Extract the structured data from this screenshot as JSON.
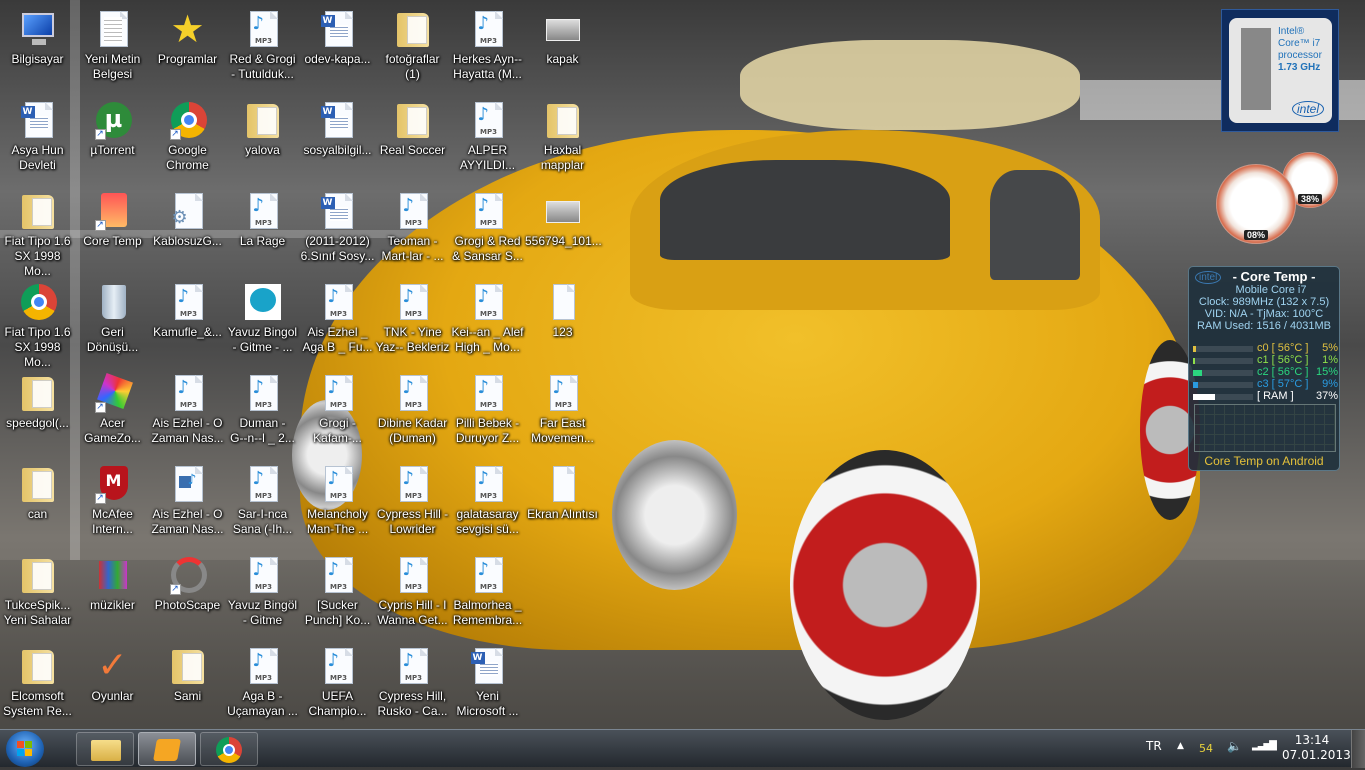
{
  "desktop": {
    "columns": [
      [
        {
          "label": "Bilgisayar",
          "icon": "computer-icon"
        },
        {
          "label": "Asya Hun\nDevleti",
          "icon": "word-document-icon"
        },
        {
          "label": "Fiat Tipo 1.6\nSX 1998 Mo...",
          "icon": "folder-icon"
        },
        {
          "label": "Fiat Tipo 1.6\nSX 1998 Mo...",
          "icon": "chrome-icon"
        },
        {
          "label": "speedgol(...",
          "icon": "folder-icon"
        },
        {
          "label": "can",
          "icon": "folder-icon"
        },
        {
          "label": "TukceSpik...\nYeni Sahalar",
          "icon": "folder-icon"
        },
        {
          "label": "Elcomsoft\nSystem Re...",
          "icon": "folder-icon"
        }
      ],
      [
        {
          "label": "Yeni Metin\nBelgesi",
          "icon": "text-document-icon"
        },
        {
          "label": "µTorrent",
          "icon": "utorrent-icon",
          "shortcut": true
        },
        {
          "label": "Core Temp",
          "icon": "core-temp-icon",
          "shortcut": true
        },
        {
          "label": "Geri\nDönüşü...",
          "icon": "recycle-bin-icon"
        },
        {
          "label": "Acer\nGameZo...",
          "icon": "acer-gamezone-icon",
          "shortcut": true
        },
        {
          "label": "McAfee\nIntern...",
          "icon": "mcafee-icon",
          "shortcut": true
        },
        {
          "label": "müzikler",
          "icon": "winrar-archive-icon"
        },
        {
          "label": "Oyunlar",
          "icon": "checkmark-icon"
        }
      ],
      [
        {
          "label": "Programlar",
          "icon": "star-icon"
        },
        {
          "label": "Google\nChrome",
          "icon": "chrome-icon",
          "shortcut": true
        },
        {
          "label": "KablosuzG...",
          "icon": "config-file-icon"
        },
        {
          "label": "Kamufle_&...",
          "icon": "mp3-icon"
        },
        {
          "label": "Ais Ezhel - O\nZaman Nas...",
          "icon": "mp3-icon"
        },
        {
          "label": "Ais Ezhel - O\nZaman Nas...",
          "icon": "video-file-icon"
        },
        {
          "label": "PhotoScape",
          "icon": "photoscape-icon",
          "shortcut": true
        },
        {
          "label": "Sami",
          "icon": "folder-icon"
        }
      ],
      [
        {
          "label": "Red & Grogi\n- Tutulduk...",
          "icon": "mp3-icon"
        },
        {
          "label": "yalova",
          "icon": "folder-icon"
        },
        {
          "label": "La Rage",
          "icon": "mp3-icon"
        },
        {
          "label": "Yavuz Bingol\n- Gitme - ...",
          "icon": "mp3-app-icon"
        },
        {
          "label": "Duman -\nG--n--l _ 2...",
          "icon": "mp3-icon"
        },
        {
          "label": "Sar-I-nca\nSana (-Ih...",
          "icon": "mp3-icon"
        },
        {
          "label": "Yavuz Bingöl\n- Gitme",
          "icon": "mp3-icon"
        },
        {
          "label": "Aga B -\nUçamayan ...",
          "icon": "mp3-icon"
        }
      ],
      [
        {
          "label": "odev-kapa...",
          "icon": "word-document-icon"
        },
        {
          "label": "sosyalbilgil...",
          "icon": "word-document-icon"
        },
        {
          "label": "(2011-2012)\n6.Sınıf Sosy...",
          "icon": "word-document-icon"
        },
        {
          "label": "Ais Ezhel _\nAga B _ Fu...",
          "icon": "mp3-icon"
        },
        {
          "label": "Grogi -\nKafam-...",
          "icon": "mp3-icon"
        },
        {
          "label": "Melancholy\nMan-The ...",
          "icon": "mp3-icon"
        },
        {
          "label": "[Sucker\nPunch] Ko...",
          "icon": "mp3-icon"
        },
        {
          "label": "UEFA\nChampio...",
          "icon": "mp3-icon"
        }
      ],
      [
        {
          "label": "fotoğraflar\n(1)",
          "icon": "folder-icon"
        },
        {
          "label": "Real Soccer",
          "icon": "folder-icon"
        },
        {
          "label": "Teoman -\nMart-lar - ...",
          "icon": "mp3-icon"
        },
        {
          "label": "TNK - Yine\nYaz-- Bekleriz",
          "icon": "mp3-icon"
        },
        {
          "label": "Dibine Kadar\n(Duman)",
          "icon": "mp3-icon"
        },
        {
          "label": "Cypress Hill -\nLowrider",
          "icon": "mp3-icon"
        },
        {
          "label": "Cypris Hill - I\nWanna Get...",
          "icon": "mp3-icon"
        },
        {
          "label": "Cypress Hill,\nRusko - Ca...",
          "icon": "mp3-icon"
        }
      ],
      [
        {
          "label": "Herkes Ayn--\nHayatta (M...",
          "icon": "mp3-icon"
        },
        {
          "label": "ALPER\nAYYILDI...",
          "icon": "mp3-icon"
        },
        {
          "label": "Grogi & Red\n& Sansar S...",
          "icon": "mp3-icon"
        },
        {
          "label": "Kei--an _ Alef\nHigh _ Mo...",
          "icon": "mp3-icon"
        },
        {
          "label": "Pilli Bebek -\nDuruyor Z...",
          "icon": "mp3-icon"
        },
        {
          "label": "galatasaray\nsevgisi sü...",
          "icon": "mp3-icon"
        },
        {
          "label": "Balmorhea _\nRemembra...",
          "icon": "mp3-icon"
        },
        {
          "label": "Yeni\nMicrosoft ...",
          "icon": "word-document-icon"
        }
      ],
      [
        {
          "label": "kapak",
          "icon": "image-icon"
        },
        {
          "label": "Haxbal\nmapplar",
          "icon": "folder-icon"
        },
        {
          "label": "556794_101...",
          "icon": "image-icon"
        },
        {
          "label": "123",
          "icon": "screenshot-icon"
        },
        {
          "label": "Far East\nMovemen...",
          "icon": "mp3-icon"
        },
        {
          "label": "Ekran Alıntısı",
          "icon": "screenshot-icon"
        }
      ]
    ]
  },
  "cpu_gadget": {
    "line1": "Intel®",
    "line2": "Core™ i7",
    "line3": "processor",
    "speed": "1.73 GHz",
    "logo": "intel"
  },
  "meter_gadget": {
    "cpu": "08%",
    "ram": "38%"
  },
  "core_temp": {
    "title": "- Core Temp -",
    "model": "Mobile Core i7",
    "clock": "Clock: 989MHz (132 x 7.5)",
    "vid": "VID: N/A - TjMax: 100°C",
    "ram": "RAM Used: 1516 / 4031MB",
    "cores": [
      {
        "label": "c0 [ 56°C ]",
        "pct": "5%",
        "load": 5,
        "color": "#e0c040"
      },
      {
        "label": "c1 [ 56°C ]",
        "pct": "1%",
        "load": 1,
        "color": "#8fe04a"
      },
      {
        "label": "c2 [ 56°C ]",
        "pct": "15%",
        "load": 15,
        "color": "#2bd67f"
      },
      {
        "label": "c3 [ 57°C ]",
        "pct": "9%",
        "load": 9,
        "color": "#2a9be0"
      },
      {
        "label": "[ RAM ]",
        "pct": "37%",
        "load": 37,
        "color": "#ffffff"
      }
    ],
    "footer": "Core Temp on Android"
  },
  "taskbar": {
    "items": [
      {
        "name": "windows-explorer",
        "state": "pinned"
      },
      {
        "name": "winamp",
        "state": "active"
      },
      {
        "name": "google-chrome",
        "state": "pinned"
      }
    ],
    "language": "TR",
    "tray_counter": "54",
    "time": "13:14",
    "date": "07.01.2013"
  }
}
